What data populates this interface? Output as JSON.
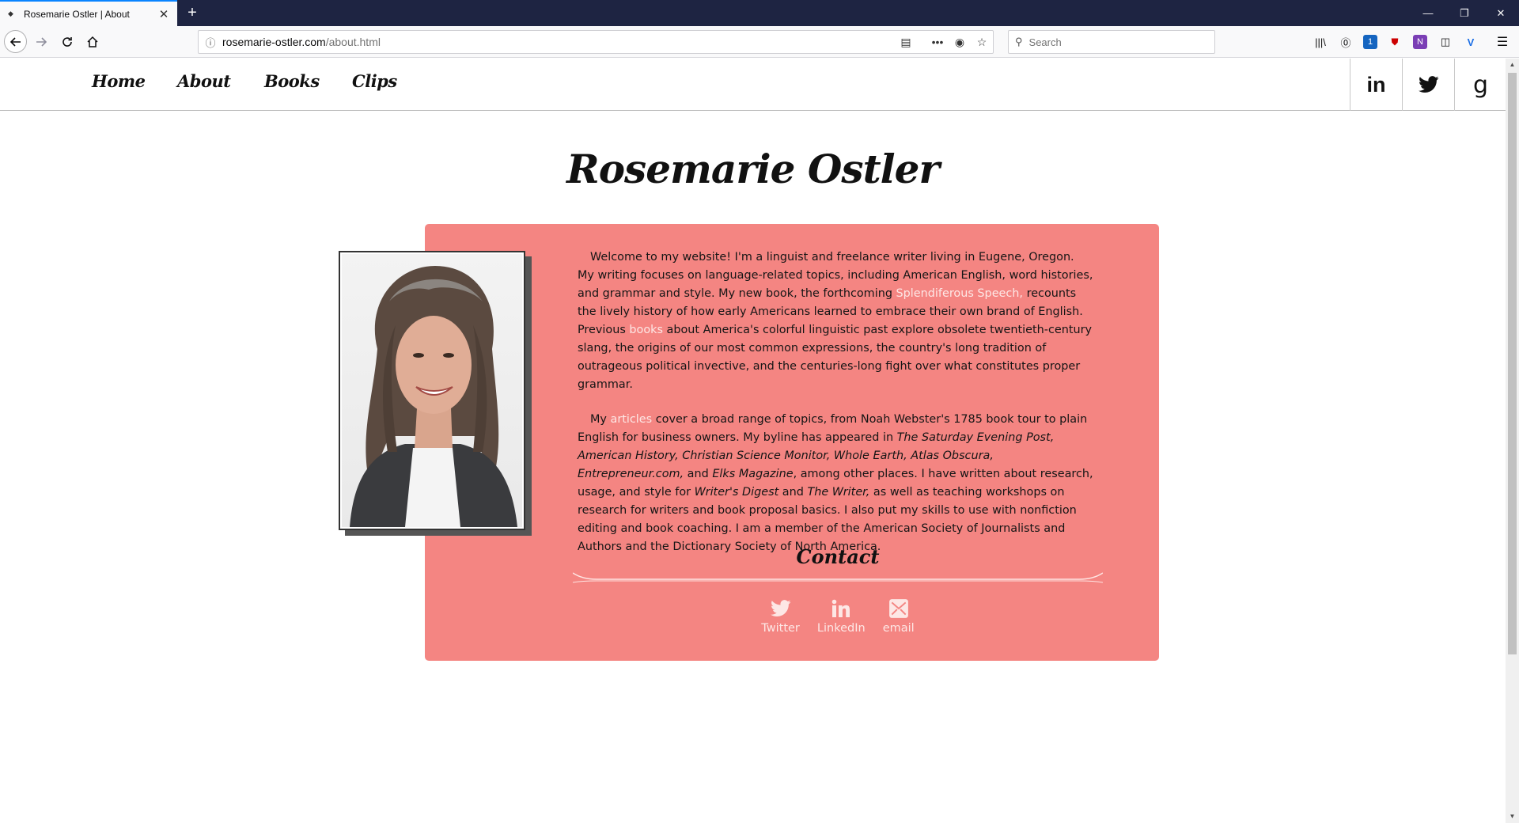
{
  "browser": {
    "tab_title": "Rosemarie Ostler | About",
    "url_host": "rosemarie-ostler.com",
    "url_path": "/about.html",
    "search_placeholder": "Search",
    "accent_color": "#0a84ff",
    "tabbar_color": "#1e2442",
    "extension_badge": "1"
  },
  "site": {
    "nav": [
      "Home",
      "About",
      "Books",
      "Clips"
    ],
    "social": [
      {
        "icon": "linkedin-icon",
        "label": "in"
      },
      {
        "icon": "twitter-icon"
      },
      {
        "icon": "goodreads-icon",
        "label": "g"
      }
    ],
    "title": "Rosemarie Ostler",
    "card_color": "#f48582",
    "bio": {
      "p1_a": "Welcome to my website! I'm a linguist and freelance writer living in Eugene, Oregon. My writing focuses on language-related topics, including American English, word histories, and grammar and style. My new book, the forthcoming ",
      "p1_link1": "Splendiferous Speech,",
      "p1_b": " recounts the lively history of how early Americans learned to embrace their own brand of English. Previous ",
      "p1_link2": "books",
      "p1_c": " about America's colorful linguistic past explore obsolete twentieth-century slang, the origins of our most common expressions, the country's long tradition of outrageous political invective, and the centuries-long fight over what constitutes proper grammar.",
      "p2_a": "My ",
      "p2_link": "articles",
      "p2_b": " cover a broad range of topics, from Noah Webster's 1785 book tour to plain English for business owners. My byline has appeared in ",
      "p2_pubs": "The Saturday Evening Post, American History, Christian Science Monitor, Whole Earth, Atlas Obscura, Entrepreneur.com,",
      "p2_and": " and ",
      "p2_elks": "Elks Magazine",
      "p2_c": ", among other places. I have written about research, usage, and style for ",
      "p2_wd": "Writer's Digest",
      "p2_and2": " and ",
      "p2_tw": "The Writer,",
      "p2_d": " as well as teaching workshops on research for writers and book proposal basics. I also put my skills to use with nonfiction editing and book coaching. I am a member of the American Society of Journalists and Authors and the Dictionary Society of North America."
    },
    "contact": {
      "heading": "Contact",
      "links": [
        {
          "icon": "twitter-icon",
          "label": "Twitter"
        },
        {
          "icon": "linkedin-icon",
          "label": "LinkedIn"
        },
        {
          "icon": "email-icon",
          "label": "email"
        }
      ]
    }
  }
}
